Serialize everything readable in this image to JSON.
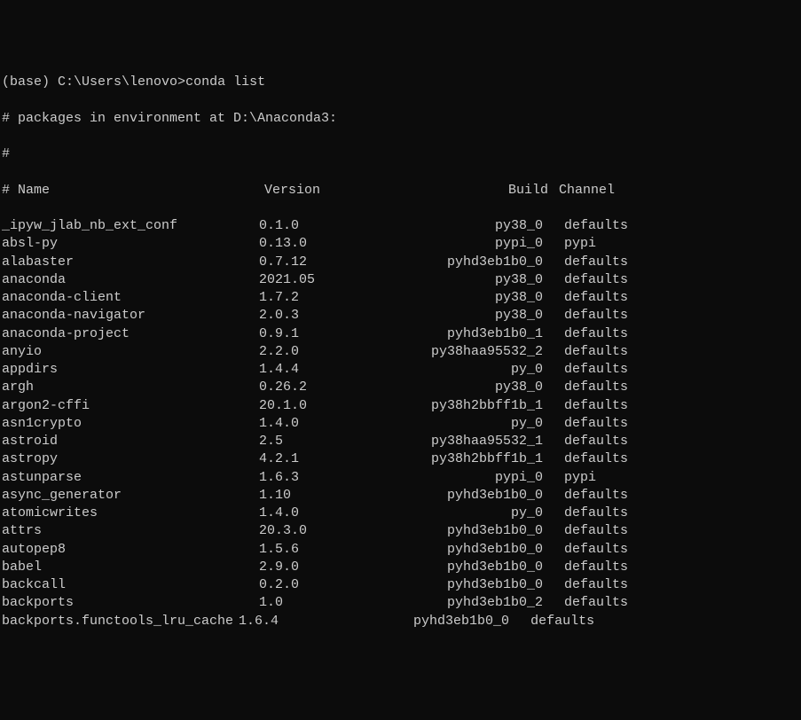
{
  "prompt": {
    "env": "(base)",
    "path": "C:\\Users\\lenovo>",
    "command": "conda list"
  },
  "comment1": "# packages in environment at D:\\Anaconda3:",
  "comment2": "#",
  "header": {
    "prefix": "#",
    "name": "Name",
    "version": "Version",
    "build": "Build",
    "channel": "Channel"
  },
  "packages": [
    {
      "name": "_ipyw_jlab_nb_ext_conf",
      "version": "0.1.0",
      "build": "py38_0",
      "channel": "defaults"
    },
    {
      "name": "absl-py",
      "version": "0.13.0",
      "build": "pypi_0",
      "channel": "pypi"
    },
    {
      "name": "alabaster",
      "version": "0.7.12",
      "build": "pyhd3eb1b0_0",
      "channel": "defaults"
    },
    {
      "name": "anaconda",
      "version": "2021.05",
      "build": "py38_0",
      "channel": "defaults"
    },
    {
      "name": "anaconda-client",
      "version": "1.7.2",
      "build": "py38_0",
      "channel": "defaults"
    },
    {
      "name": "anaconda-navigator",
      "version": "2.0.3",
      "build": "py38_0",
      "channel": "defaults"
    },
    {
      "name": "anaconda-project",
      "version": "0.9.1",
      "build": "pyhd3eb1b0_1",
      "channel": "defaults"
    },
    {
      "name": "anyio",
      "version": "2.2.0",
      "build": "py38haa95532_2",
      "channel": "defaults"
    },
    {
      "name": "appdirs",
      "version": "1.4.4",
      "build": "py_0",
      "channel": "defaults"
    },
    {
      "name": "argh",
      "version": "0.26.2",
      "build": "py38_0",
      "channel": "defaults"
    },
    {
      "name": "argon2-cffi",
      "version": "20.1.0",
      "build": "py38h2bbff1b_1",
      "channel": "defaults"
    },
    {
      "name": "asn1crypto",
      "version": "1.4.0",
      "build": "py_0",
      "channel": "defaults"
    },
    {
      "name": "astroid",
      "version": "2.5",
      "build": "py38haa95532_1",
      "channel": "defaults"
    },
    {
      "name": "astropy",
      "version": "4.2.1",
      "build": "py38h2bbff1b_1",
      "channel": "defaults"
    },
    {
      "name": "astunparse",
      "version": "1.6.3",
      "build": "pypi_0",
      "channel": "pypi"
    },
    {
      "name": "async_generator",
      "version": "1.10",
      "build": "pyhd3eb1b0_0",
      "channel": "defaults"
    },
    {
      "name": "atomicwrites",
      "version": "1.4.0",
      "build": "py_0",
      "channel": "defaults"
    },
    {
      "name": "attrs",
      "version": "20.3.0",
      "build": "pyhd3eb1b0_0",
      "channel": "defaults"
    },
    {
      "name": "autopep8",
      "version": "1.5.6",
      "build": "pyhd3eb1b0_0",
      "channel": "defaults"
    },
    {
      "name": "babel",
      "version": "2.9.0",
      "build": "pyhd3eb1b0_0",
      "channel": "defaults"
    },
    {
      "name": "backcall",
      "version": "0.2.0",
      "build": "pyhd3eb1b0_0",
      "channel": "defaults"
    },
    {
      "name": "backports",
      "version": "1.0",
      "build": "pyhd3eb1b0_2",
      "channel": "defaults"
    },
    {
      "name": "backports.functools_lru_cache",
      "version": "1.6.4",
      "build": "pyhd3eb1b0_0",
      "channel": "defaults"
    }
  ]
}
